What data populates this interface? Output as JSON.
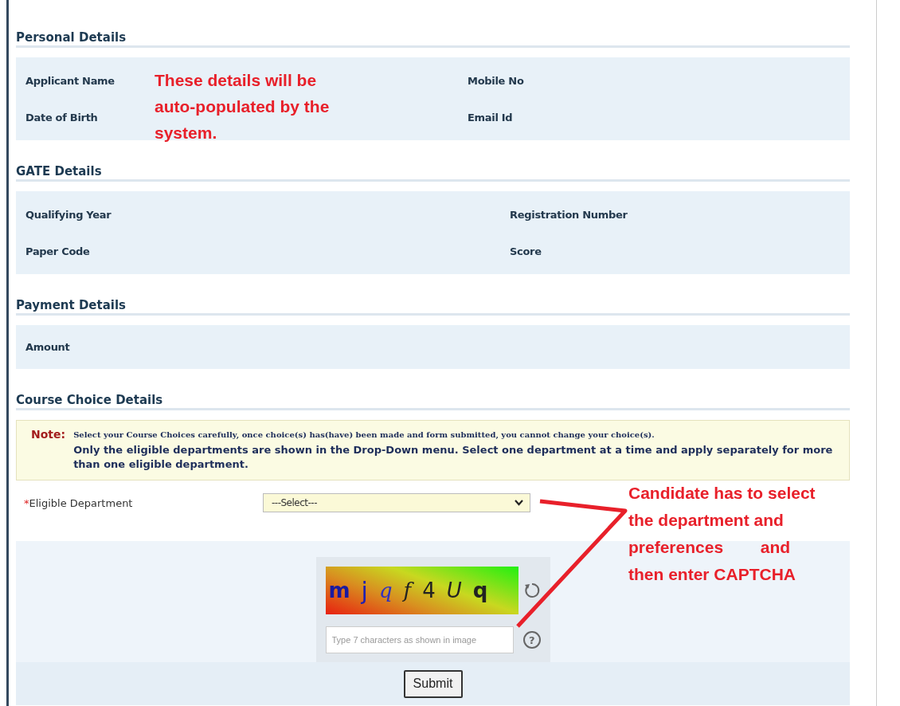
{
  "sections": [
    {
      "title": "Personal Details",
      "kind": "fields",
      "fields": [
        {
          "label": "Applicant Name"
        },
        {
          "label": "Mobile No"
        },
        {
          "label": "Date of Birth"
        },
        {
          "label": "Email Id"
        }
      ]
    },
    {
      "title": "GATE Details",
      "kind": "fields",
      "fields": [
        {
          "label": "Qualifying Year"
        },
        {
          "label": "Registration Number"
        },
        {
          "label": "Paper Code"
        },
        {
          "label": "Score"
        }
      ]
    },
    {
      "title": "Payment Details",
      "kind": "fields",
      "fields": [
        {
          "label": "Amount"
        }
      ]
    },
    {
      "title": "Course Choice Details",
      "kind": "course"
    }
  ],
  "note": {
    "label": "Note:",
    "small": "Select your Course Choices carefully, once choice(s) has(have) been made and form submitted, you cannot change your choice(s).",
    "text": "Only the eligible departments are shown in the Drop-Down menu. Select one department at a time and apply separately for more than one eligible department."
  },
  "department": {
    "required_mark": "*",
    "label": "Eligible Department",
    "value": "---Select---"
  },
  "captcha": {
    "characters": [
      "m",
      "j",
      "q",
      "f",
      "4",
      "U",
      "q"
    ],
    "placeholder": "Type 7 characters as shown in image",
    "help": "?"
  },
  "submit": "Submit",
  "annotations": [
    {
      "text": "These details will be\nauto-populated by the\nsystem."
    },
    {
      "text": "Candidate has to select\nthe department and\npreferences        and\nthen enter CAPTCHA"
    }
  ]
}
